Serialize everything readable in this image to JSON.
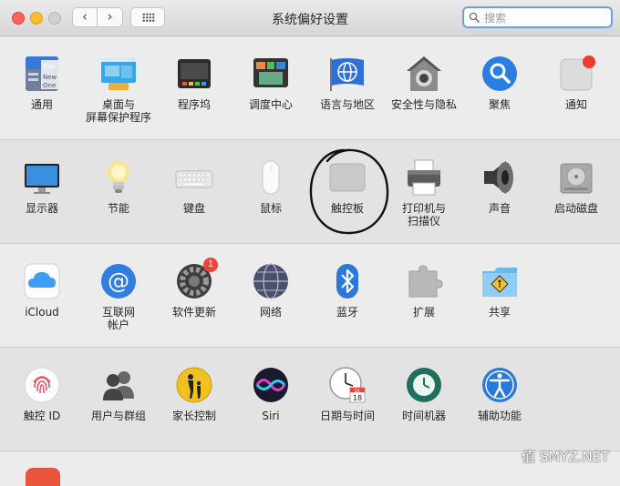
{
  "window": {
    "title": "系统偏好设置"
  },
  "toolbar": {
    "back_label": "‹",
    "forward_label": "›"
  },
  "search": {
    "placeholder": "搜索"
  },
  "rows": [
    [
      {
        "label": "通用"
      },
      {
        "label": "桌面与\n屏幕保护程序"
      },
      {
        "label": "程序坞"
      },
      {
        "label": "调度中心"
      },
      {
        "label": "语言与地区"
      },
      {
        "label": "安全性与隐私"
      },
      {
        "label": "聚焦"
      },
      {
        "label": "通知"
      }
    ],
    [
      {
        "label": "显示器"
      },
      {
        "label": "节能"
      },
      {
        "label": "键盘"
      },
      {
        "label": "鼠标"
      },
      {
        "label": "触控板"
      },
      {
        "label": "打印机与\n扫描仪"
      },
      {
        "label": "声音"
      },
      {
        "label": "启动磁盘"
      }
    ],
    [
      {
        "label": "iCloud"
      },
      {
        "label": "互联网\n帐户"
      },
      {
        "label": "软件更新",
        "badge": "1"
      },
      {
        "label": "网络"
      },
      {
        "label": "蓝牙"
      },
      {
        "label": "扩展"
      },
      {
        "label": "共享"
      }
    ],
    [
      {
        "label": "触控 ID"
      },
      {
        "label": "用户与群组"
      },
      {
        "label": "家长控制"
      },
      {
        "label": "Siri"
      },
      {
        "label": "日期与时间"
      },
      {
        "label": "时间机器"
      },
      {
        "label": "辅助功能"
      }
    ]
  ],
  "icon_texts": {
    "file_line1": "File",
    "file_line2": "New",
    "file_line3": "One",
    "calendar_month": "JUL",
    "calendar_day": "18"
  },
  "watermark": "值 SMYZ.NET"
}
